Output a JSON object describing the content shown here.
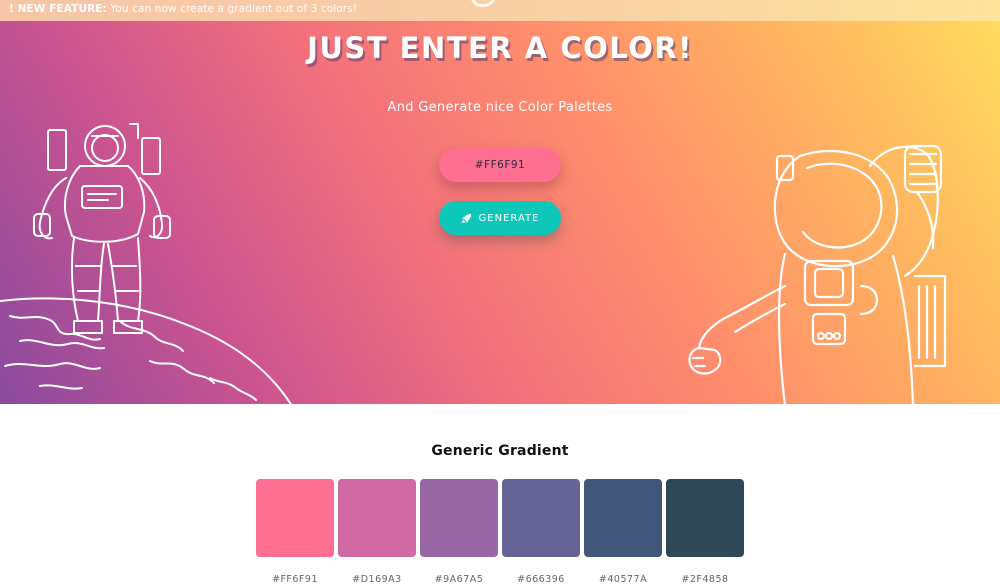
{
  "announcement": {
    "label": "! NEW FEATURE:",
    "text": " You can now create a gradient out of 3 colors!"
  },
  "hero": {
    "title": "JUST ENTER A COLOR!",
    "subtitle": "And Generate nice Color Palettes",
    "color_input_value": "#FF6F91",
    "generate_label": "GENERATE",
    "generate_icon": "rocket-icon",
    "background_colors": [
      "#8a4a9e",
      "#cc5490",
      "#ff8e6c",
      "#ffdc5e"
    ]
  },
  "palette_section": {
    "title": "Generic Gradient",
    "swatches": [
      {
        "color": "#FF6F91",
        "hex": "#FF6F91"
      },
      {
        "color": "#D169A3",
        "hex": "#D169A3"
      },
      {
        "color": "#9A67A5",
        "hex": "#9A67A5"
      },
      {
        "color": "#666396",
        "hex": "#666396"
      },
      {
        "color": "#40577A",
        "hex": "#40577A"
      },
      {
        "color": "#2F4858",
        "hex": "#2F4858"
      }
    ]
  }
}
